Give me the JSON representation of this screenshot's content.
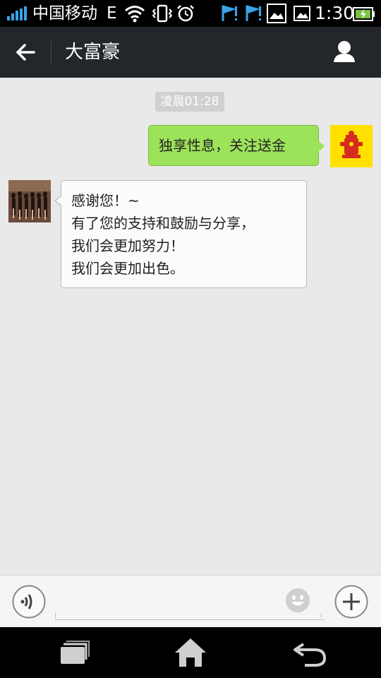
{
  "status_bar": {
    "carrier": "中国移动",
    "network": "E",
    "time": "1:30"
  },
  "title_bar": {
    "title": "大富豪",
    "back_icon": "arrow-left-icon",
    "profile_icon": "person-icon"
  },
  "chat": {
    "timestamp": "凌晨01:28",
    "messages": [
      {
        "from": "self",
        "text": "独享性息，关注送金"
      },
      {
        "from": "other",
        "lines": [
          "感谢您！~",
          "有了您的支持和鼓励与分享，",
          "我们会更加努力！",
          "我们会更加出色。"
        ]
      }
    ]
  },
  "input_bar": {
    "value": "",
    "voice_icon": "voice-icon",
    "emoji_icon": "smiley-icon",
    "plus_icon": "plus-icon"
  },
  "nav_bar": {
    "icons": [
      "recent-apps-icon",
      "home-icon",
      "back-icon"
    ]
  },
  "colors": {
    "sent_bubble": "#9de35a",
    "received_bubble": "#fbfbfb",
    "title_bar": "#23272b",
    "chat_bg": "#e9e9e9",
    "self_avatar_bg": "#ffe000"
  }
}
